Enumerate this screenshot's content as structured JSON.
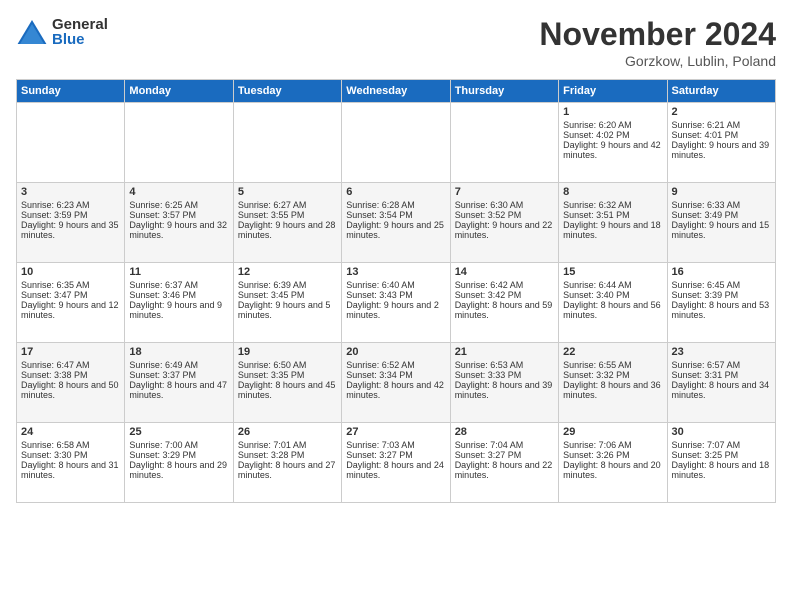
{
  "logo": {
    "general": "General",
    "blue": "Blue"
  },
  "title": "November 2024",
  "location": "Gorzkow, Lublin, Poland",
  "days_of_week": [
    "Sunday",
    "Monday",
    "Tuesday",
    "Wednesday",
    "Thursday",
    "Friday",
    "Saturday"
  ],
  "weeks": [
    [
      {
        "day": "",
        "info": ""
      },
      {
        "day": "",
        "info": ""
      },
      {
        "day": "",
        "info": ""
      },
      {
        "day": "",
        "info": ""
      },
      {
        "day": "",
        "info": ""
      },
      {
        "day": "1",
        "info": "Sunrise: 6:20 AM\nSunset: 4:02 PM\nDaylight: 9 hours and 42 minutes."
      },
      {
        "day": "2",
        "info": "Sunrise: 6:21 AM\nSunset: 4:01 PM\nDaylight: 9 hours and 39 minutes."
      }
    ],
    [
      {
        "day": "3",
        "info": "Sunrise: 6:23 AM\nSunset: 3:59 PM\nDaylight: 9 hours and 35 minutes."
      },
      {
        "day": "4",
        "info": "Sunrise: 6:25 AM\nSunset: 3:57 PM\nDaylight: 9 hours and 32 minutes."
      },
      {
        "day": "5",
        "info": "Sunrise: 6:27 AM\nSunset: 3:55 PM\nDaylight: 9 hours and 28 minutes."
      },
      {
        "day": "6",
        "info": "Sunrise: 6:28 AM\nSunset: 3:54 PM\nDaylight: 9 hours and 25 minutes."
      },
      {
        "day": "7",
        "info": "Sunrise: 6:30 AM\nSunset: 3:52 PM\nDaylight: 9 hours and 22 minutes."
      },
      {
        "day": "8",
        "info": "Sunrise: 6:32 AM\nSunset: 3:51 PM\nDaylight: 9 hours and 18 minutes."
      },
      {
        "day": "9",
        "info": "Sunrise: 6:33 AM\nSunset: 3:49 PM\nDaylight: 9 hours and 15 minutes."
      }
    ],
    [
      {
        "day": "10",
        "info": "Sunrise: 6:35 AM\nSunset: 3:47 PM\nDaylight: 9 hours and 12 minutes."
      },
      {
        "day": "11",
        "info": "Sunrise: 6:37 AM\nSunset: 3:46 PM\nDaylight: 9 hours and 9 minutes."
      },
      {
        "day": "12",
        "info": "Sunrise: 6:39 AM\nSunset: 3:45 PM\nDaylight: 9 hours and 5 minutes."
      },
      {
        "day": "13",
        "info": "Sunrise: 6:40 AM\nSunset: 3:43 PM\nDaylight: 9 hours and 2 minutes."
      },
      {
        "day": "14",
        "info": "Sunrise: 6:42 AM\nSunset: 3:42 PM\nDaylight: 8 hours and 59 minutes."
      },
      {
        "day": "15",
        "info": "Sunrise: 6:44 AM\nSunset: 3:40 PM\nDaylight: 8 hours and 56 minutes."
      },
      {
        "day": "16",
        "info": "Sunrise: 6:45 AM\nSunset: 3:39 PM\nDaylight: 8 hours and 53 minutes."
      }
    ],
    [
      {
        "day": "17",
        "info": "Sunrise: 6:47 AM\nSunset: 3:38 PM\nDaylight: 8 hours and 50 minutes."
      },
      {
        "day": "18",
        "info": "Sunrise: 6:49 AM\nSunset: 3:37 PM\nDaylight: 8 hours and 47 minutes."
      },
      {
        "day": "19",
        "info": "Sunrise: 6:50 AM\nSunset: 3:35 PM\nDaylight: 8 hours and 45 minutes."
      },
      {
        "day": "20",
        "info": "Sunrise: 6:52 AM\nSunset: 3:34 PM\nDaylight: 8 hours and 42 minutes."
      },
      {
        "day": "21",
        "info": "Sunrise: 6:53 AM\nSunset: 3:33 PM\nDaylight: 8 hours and 39 minutes."
      },
      {
        "day": "22",
        "info": "Sunrise: 6:55 AM\nSunset: 3:32 PM\nDaylight: 8 hours and 36 minutes."
      },
      {
        "day": "23",
        "info": "Sunrise: 6:57 AM\nSunset: 3:31 PM\nDaylight: 8 hours and 34 minutes."
      }
    ],
    [
      {
        "day": "24",
        "info": "Sunrise: 6:58 AM\nSunset: 3:30 PM\nDaylight: 8 hours and 31 minutes."
      },
      {
        "day": "25",
        "info": "Sunrise: 7:00 AM\nSunset: 3:29 PM\nDaylight: 8 hours and 29 minutes."
      },
      {
        "day": "26",
        "info": "Sunrise: 7:01 AM\nSunset: 3:28 PM\nDaylight: 8 hours and 27 minutes."
      },
      {
        "day": "27",
        "info": "Sunrise: 7:03 AM\nSunset: 3:27 PM\nDaylight: 8 hours and 24 minutes."
      },
      {
        "day": "28",
        "info": "Sunrise: 7:04 AM\nSunset: 3:27 PM\nDaylight: 8 hours and 22 minutes."
      },
      {
        "day": "29",
        "info": "Sunrise: 7:06 AM\nSunset: 3:26 PM\nDaylight: 8 hours and 20 minutes."
      },
      {
        "day": "30",
        "info": "Sunrise: 7:07 AM\nSunset: 3:25 PM\nDaylight: 8 hours and 18 minutes."
      }
    ]
  ]
}
